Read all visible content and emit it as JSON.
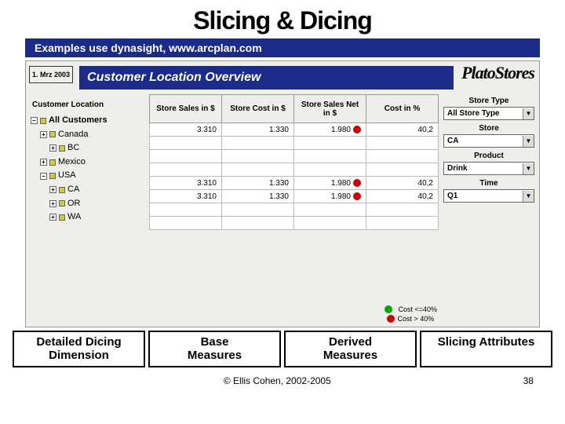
{
  "slide": {
    "title": "Slicing & Dicing",
    "subtitle": "Examples use dynasight, www.arcplan.com"
  },
  "app": {
    "date": "1. Mrz 2003",
    "title": "Customer Location Overview",
    "logo": "PlatoStores",
    "left_label": "Customer Location",
    "tree": [
      {
        "exp": "−",
        "label": "All Customers",
        "pad": "nopad",
        "bold": true
      },
      {
        "exp": "+",
        "label": "Canada",
        "pad": "p1"
      },
      {
        "exp": "+",
        "label": "BC",
        "pad": "p2"
      },
      {
        "exp": "+",
        "label": "Mexico",
        "pad": "p1"
      },
      {
        "exp": "−",
        "label": "USA",
        "pad": "p1"
      },
      {
        "exp": "+",
        "label": "CA",
        "pad": "p2"
      },
      {
        "exp": "+",
        "label": "OR",
        "pad": "p2"
      },
      {
        "exp": "+",
        "label": "WA",
        "pad": "p2"
      }
    ],
    "columns": [
      "Store Sales in $",
      "Store Cost in $",
      "Store Sales Net in $",
      "Cost in %"
    ],
    "rows": [
      {
        "v": [
          "3.310",
          "1.330",
          "1.980",
          "40,2"
        ],
        "flag": true
      },
      {
        "v": [],
        "flag": false
      },
      {
        "v": [],
        "flag": false
      },
      {
        "v": [],
        "flag": false
      },
      {
        "v": [
          "3.310",
          "1.330",
          "1.980",
          "40,2"
        ],
        "flag": true
      },
      {
        "v": [
          "3.310",
          "1.330",
          "1.980",
          "40,2"
        ],
        "flag": true
      },
      {
        "v": [],
        "flag": false
      },
      {
        "v": [],
        "flag": false
      }
    ],
    "filters": [
      {
        "label": "Store Type",
        "value": "All Store Type"
      },
      {
        "label": "Store",
        "value": "CA"
      },
      {
        "label": "Product",
        "value": "Drink"
      },
      {
        "label": "Time",
        "value": "Q1"
      }
    ],
    "legend": {
      "low": "Cost <=40%",
      "high": "Cost > 40%"
    }
  },
  "annotations": [
    "Detailed Dicing Dimension",
    "Base Measures",
    "Derived Measures",
    "Slicing Attributes"
  ],
  "footer": {
    "copyright": "© Ellis Cohen, 2002-2005",
    "page": "38"
  }
}
